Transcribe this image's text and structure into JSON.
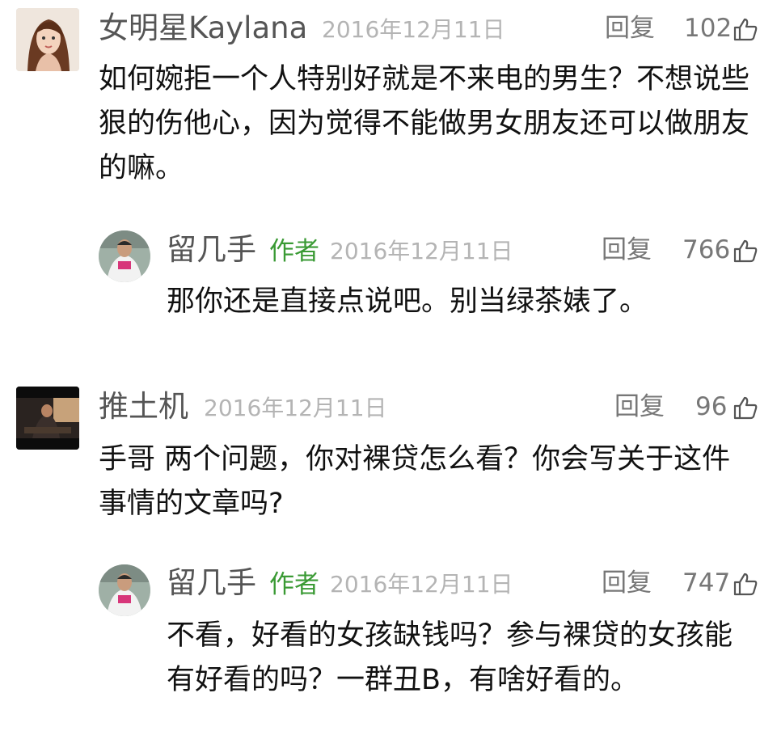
{
  "comments": [
    {
      "name": "女明星Kaylana",
      "date": "2016年12月11日",
      "reply_label": "回复",
      "likes": "102",
      "text": "如何婉拒一个人特别好就是不来电的男生？不想说些狠的伤他心，因为觉得不能做男女朋友还可以做朋友的嘛。",
      "reply": {
        "name": "留几手",
        "author_tag": "作者",
        "date": "2016年12月11日",
        "reply_label": "回复",
        "likes": "766",
        "text": "那你还是直接点说吧。别当绿茶婊了。"
      }
    },
    {
      "name": "推土机",
      "date": "2016年12月11日",
      "reply_label": "回复",
      "likes": "96",
      "text": "手哥 两个问题，你对裸贷怎么看？你会写关于这件事情的文章吗?",
      "reply": {
        "name": "留几手",
        "author_tag": "作者",
        "date": "2016年12月11日",
        "reply_label": "回复",
        "likes": "747",
        "text": "不看，好看的女孩缺钱吗？参与裸贷的女孩能有好看的吗？一群丑B，有啥好看的。"
      }
    }
  ],
  "icons": {
    "like": "thumbs-up-icon"
  },
  "colors": {
    "author_tag": "#3a9a34",
    "date": "#b4b4b4",
    "meta": "#777777"
  }
}
